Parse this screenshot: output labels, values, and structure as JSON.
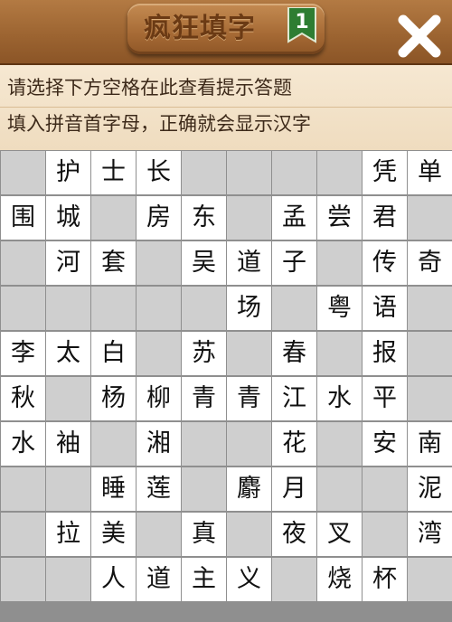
{
  "header": {
    "title": "疯狂填字",
    "level": "1",
    "close_icon": "close-x-icon"
  },
  "hint": {
    "line1": "请选择下方空格在此查看提示答题",
    "line2": "填入拼音首字母，正确就会显示汉字"
  },
  "colors": {
    "header_wood": "#9c6431",
    "title_text": "#6b3a14",
    "badge_green": "#2e7d32",
    "hint_bg": "#f6e8d2",
    "cell_filled": "#ffffff",
    "cell_blank": "#cfcfcf",
    "grid_line": "#8f8f8f"
  },
  "grid": [
    [
      "",
      "护",
      "士",
      "长",
      "",
      "",
      "",
      "",
      "凭",
      "单"
    ],
    [
      "围",
      "城",
      "",
      "房",
      "东",
      "",
      "孟",
      "尝",
      "君",
      ""
    ],
    [
      "",
      "河",
      "套",
      "",
      "吴",
      "道",
      "子",
      "",
      "传",
      "奇"
    ],
    [
      "",
      "",
      "",
      "",
      "",
      "场",
      "",
      "粤",
      "语",
      ""
    ],
    [
      "李",
      "太",
      "白",
      "",
      "苏",
      "",
      "春",
      "",
      "报",
      ""
    ],
    [
      "秋",
      "",
      "杨",
      "柳",
      "青",
      "青",
      "江",
      "水",
      "平",
      ""
    ],
    [
      "水",
      "袖",
      "",
      "湘",
      "",
      "",
      "花",
      "",
      "安",
      "南"
    ],
    [
      "",
      "",
      "睡",
      "莲",
      "",
      "麝",
      "月",
      "",
      "",
      "泥"
    ],
    [
      "",
      "拉",
      "美",
      "",
      "真",
      "",
      "夜",
      "叉",
      "",
      "湾"
    ],
    [
      "",
      "",
      "人",
      "道",
      "主",
      "义",
      "",
      "烧",
      "杯",
      ""
    ]
  ]
}
